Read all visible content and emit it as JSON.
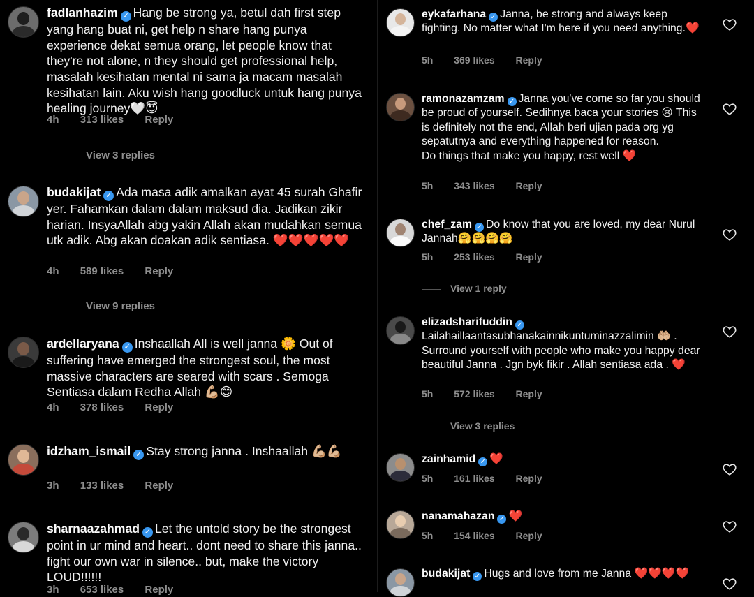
{
  "colors": {
    "background": "#000000",
    "text": "#f5f5f5",
    "meta": "#8e8e8e",
    "verified_badge": "#3897f0",
    "heart_emoji": "#e8323c"
  },
  "comments": [
    {
      "username": "fadlanhazim",
      "verified": true,
      "text": "Hang be strong ya, betul dah first step yang hang buat ni, get help n share hang punya experience dekat semua orang, let people know that they're not alone, n they should get professional help, masalah kesihatan mental ni sama ja macam masalah kesihatan lain. Aku wish hang goodluck untuk hang punya healing journey🤍😇",
      "time": "4h",
      "likes": "313 likes",
      "reply": "Reply",
      "view_replies": "View 3 replies",
      "avatar_icon": "user-avatar-icon"
    },
    {
      "username": "budakijat",
      "verified": true,
      "text": "Ada masa adik amalkan ayat 45 surah Ghafir yer. Fahamkan dalam dalam maksud dia. Jadikan zikir harian. InsyaAllah abg yakin Allah akan mudahkan semua utk adik. Abg akan doakan adik sentiasa. ❤️❤️❤️❤️❤️",
      "time": "4h",
      "likes": "589 likes",
      "reply": "Reply",
      "view_replies": "View 9 replies",
      "avatar_icon": "user-avatar-icon"
    },
    {
      "username": "ardellaryana",
      "verified": true,
      "text": "Inshaallah All is well janna 🌼 Out of suffering have emerged the strongest soul, the most massive characters are seared with scars . Semoga Sentiasa dalam Redha Allah 💪🏼😊",
      "time": "4h",
      "likes": "378 likes",
      "reply": "Reply",
      "avatar_icon": "user-avatar-icon"
    },
    {
      "username": "idzham_ismail",
      "verified": true,
      "text": "Stay strong janna . Inshaallah 💪🏼💪🏼",
      "time": "3h",
      "likes": "133 likes",
      "reply": "Reply",
      "avatar_icon": "user-avatar-icon"
    },
    {
      "username": "sharnaazahmad",
      "verified": true,
      "text": "Let the untold story be the strongest point in ur mind and heart.. dont need to share this janna.. fight our own war in silence.. but, make the victory LOUD!!!!!!",
      "time": "3h",
      "likes": "653 likes",
      "reply": "Reply",
      "avatar_icon": "user-avatar-icon"
    },
    {
      "username": "eykafarhana",
      "verified": true,
      "text": "Janna, be strong and always keep fighting. No matter what I'm here if you need anything.❤️",
      "time": "5h",
      "likes": "369 likes",
      "reply": "Reply",
      "avatar_icon": "user-avatar-icon"
    },
    {
      "username": "ramonazamzam",
      "verified": true,
      "text": "Janna you've come so far you should be proud of yourself. Sedihnya baca your stories 😢 This is definitely not the end, Allah beri ujian pada org yg sepatutnya and everything happened for reason.\nDo things that make you happy, rest well ❤️",
      "time": "5h",
      "likes": "343 likes",
      "reply": "Reply",
      "avatar_icon": "user-avatar-icon"
    },
    {
      "username": "chef_zam",
      "verified": true,
      "text": "Do know that you are loved, my dear Nurul Jannah🤗🤗🤗🤗",
      "time": "5h",
      "likes": "253 likes",
      "reply": "Reply",
      "view_replies": "View 1 reply",
      "avatar_icon": "user-avatar-icon"
    },
    {
      "username": "elizadsharifuddin",
      "verified": true,
      "text": "Lailahaillaantasubhanakainnikuntuminazzalimin 🤲🏼 . Surround yourself with people who make you happy dear beautiful Janna . Jgn byk fikir . Allah sentiasa ada . ❤️",
      "time": "5h",
      "likes": "572 likes",
      "reply": "Reply",
      "view_replies": "View 3 replies",
      "avatar_icon": "user-avatar-icon"
    },
    {
      "username": "zainhamid",
      "verified": true,
      "text": "❤️",
      "time": "5h",
      "likes": "161 likes",
      "reply": "Reply",
      "avatar_icon": "user-avatar-icon"
    },
    {
      "username": "nanamahazan",
      "verified": true,
      "text": "❤️",
      "time": "5h",
      "likes": "154 likes",
      "reply": "Reply",
      "avatar_icon": "user-avatar-icon"
    },
    {
      "username": "budakijat",
      "verified": true,
      "text": "Hugs and love from me Janna ❤️❤️❤️❤️",
      "avatar_icon": "user-avatar-icon"
    }
  ],
  "icons": {
    "verified": "verified-badge-icon",
    "like": "heart-outline-icon",
    "verified_glyph": "✓"
  }
}
